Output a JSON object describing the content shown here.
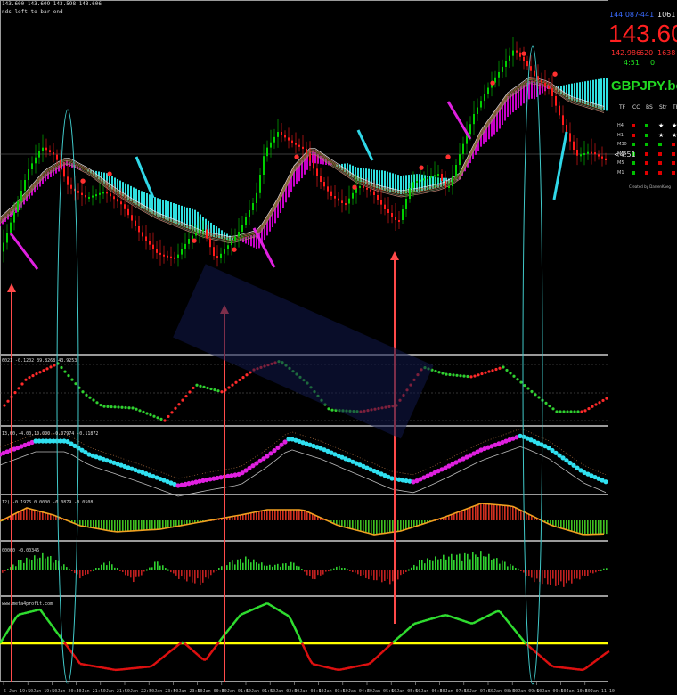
{
  "header": {
    "ohlc": "143.600 143.609 143.598 143.606",
    "note": "nds left to bar end"
  },
  "quote": {
    "ask": "144.087",
    "change": "-441",
    "range": "1061",
    "price": "143.606",
    "prev": "142.986",
    "pips": "620",
    "spread": "1638",
    "timer": "4:51",
    "zero": "0"
  },
  "symbol": "GBPJPY.bo",
  "matrix": {
    "headers": [
      "TF",
      "CC",
      "BS",
      "Str",
      "TR"
    ],
    "rows": [
      {
        "tf": "H4",
        "cells": [
          "#e00000",
          "#00c000",
          "star",
          "star",
          "#00c000"
        ]
      },
      {
        "tf": "H1",
        "cells": [
          "#e00000",
          "#00c000",
          "star",
          "star",
          "#00c000"
        ]
      },
      {
        "tf": "M30",
        "cells": [
          "#00c000",
          "#00c000",
          "#00c000",
          "#e00000",
          "#00c000"
        ]
      },
      {
        "tf": "M15",
        "cells": [
          "#00c000",
          "#e00000",
          "#e00000",
          "#e00000",
          "#e00000"
        ]
      },
      {
        "tf": "M5",
        "cells": [
          "#00c000",
          "#e00000",
          "#e00000",
          "#e00000",
          "#e00000"
        ]
      },
      {
        "tf": "M1",
        "cells": [
          "#00c000",
          "#e00000",
          "#e00000",
          "#e00000",
          "#e00000"
        ]
      }
    ],
    "price_tag": "<4:51",
    "credit": "Created by DarrenKaeg"
  },
  "indicators": [
    {
      "label": "6021 -0.1202 39.8268 43.9253"
    },
    {
      "label": "13,00,-4.00,10.000 -0.07974 -0.11872"
    },
    {
      "label": "12) -0.1976 0.0000 -0.0879 -0.0508"
    },
    {
      "label": "00000 -0.00346"
    },
    {
      "label": "www.meta4profit.com"
    }
  ],
  "time_labels": [
    "5 Jan 19:10",
    "5 Jan 19:50",
    "5 Jan 20:30",
    "5 Jan 21:10",
    "5 Jan 21:50",
    "5 Jan 22:30",
    "5 Jan 23:10",
    "5 Jan 23:50",
    "6 Jan 00:30",
    "6 Jan 01:10",
    "6 Jan 01:50",
    "6 Jan 02:30",
    "6 Jan 03:10",
    "6 Jan 03:50",
    "6 Jan 04:30",
    "6 Jan 05:10",
    "6 Jan 05:50",
    "6 Jan 06:30",
    "6 Jan 07:10",
    "6 Jan 07:50",
    "6 Jan 08:30",
    "6 Jan 09:10",
    "6 Jan 09:50",
    "6 Jan 10:30",
    "6 Jan 11:10"
  ],
  "colors": {
    "bull": "#00d000",
    "bear": "#ff1a1a",
    "cloud_bull": "#c800c8",
    "cloud_bear": "#30e0e0",
    "zero_line": "#ffff00",
    "arrow": "#ff4a4a",
    "ellipse": "#40c8c8"
  }
}
